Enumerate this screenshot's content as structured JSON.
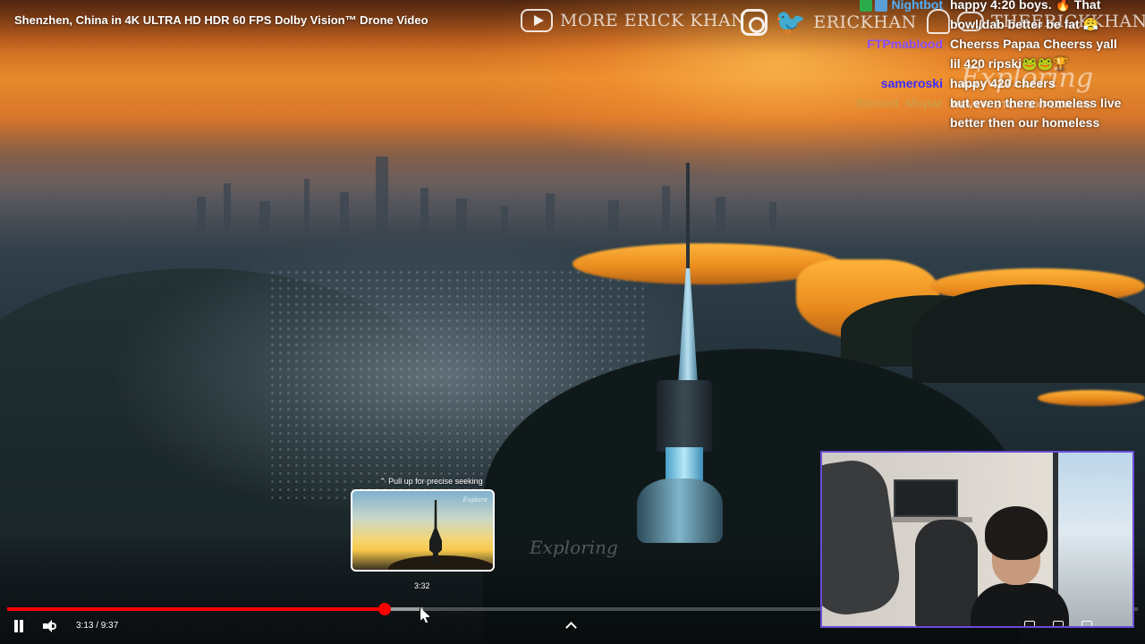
{
  "video": {
    "title": "Shenzhen, China in 4K ULTRA HD HDR 60 FPS Dolby Vision™ Drone Video",
    "watermark_center": "Exploring"
  },
  "social": {
    "youtube_label": "MORE ERICK KHAN",
    "handle_twitter": "ERICKHAN",
    "handle_discord": "THEERICKKHAN"
  },
  "chat": {
    "messages": [
      {
        "user": "Nightbot",
        "user_color": "#4fb0ff",
        "text": "happy 4:20 boys. 🔥 That bowl/dab better be fat 😤"
      },
      {
        "user": "FTPmablood",
        "user_color": "#8a4dff",
        "text": "Cheerss Papaa Cheerss yall lil 420 ripski🐸🐸🏆"
      },
      {
        "user": "sameroski",
        "user_color": "#3b2cff",
        "text": "happy 420 cheers"
      },
      {
        "user": "Stoned_Mopar",
        "user_color": "#c9a24a",
        "text": "but even there homeless live better then our homeless"
      }
    ],
    "brand_script": "Exploring",
    "brand_tag": "NEVER STOP EXPLORING"
  },
  "seek": {
    "hint": "Pull up for precise seeking",
    "thumb_label": "Explore",
    "preview_time": "3:32"
  },
  "controls": {
    "time_display": "3:13 / 9:37",
    "played_fraction": 0.334,
    "loaded_fraction": 0.368
  },
  "colors": {
    "progress_played": "#ff0000",
    "webcam_border": "#6b4bd6"
  }
}
